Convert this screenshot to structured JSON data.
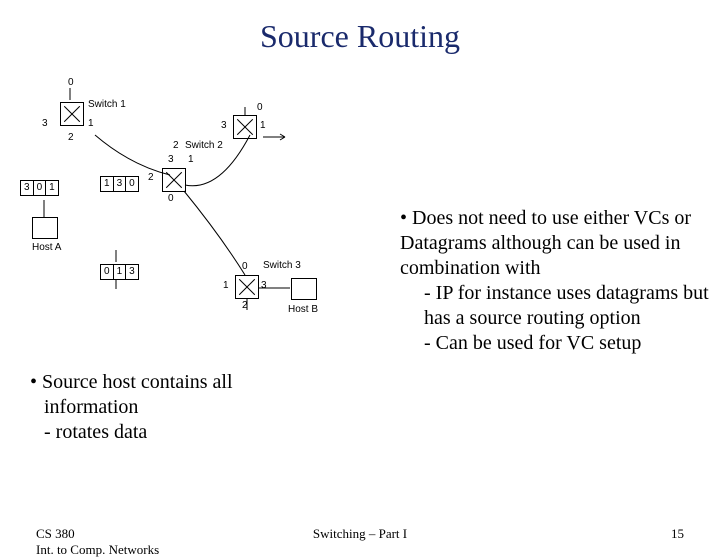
{
  "title": "Source Routing",
  "diagram": {
    "switches": [
      {
        "name": "Switch 1",
        "ports": {
          "top": "0",
          "left": "3",
          "right": "1",
          "bottom": "2"
        }
      },
      {
        "name": "Switch 2",
        "ports": {
          "top": "0",
          "left": "3",
          "right": "1",
          "bottom": "2"
        }
      },
      {
        "name": "",
        "ports": {
          "top": "3",
          "left": "2",
          "right": "1",
          "bottom": "0"
        }
      },
      {
        "name": "Switch 3",
        "ports": {
          "top": "0",
          "left": "1",
          "right": "3",
          "bottom": "2"
        }
      }
    ],
    "hosts": [
      {
        "name": "Host A"
      },
      {
        "name": "Host B"
      }
    ],
    "packets": [
      {
        "cells": [
          "3",
          "0",
          "1"
        ]
      },
      {
        "cells": [
          "1",
          "3",
          "0"
        ]
      },
      {
        "cells": [
          "0",
          "1",
          "3"
        ]
      }
    ]
  },
  "left_bullet": {
    "lead": "• Source host contains all",
    "line2": "information",
    "line3": "- rotates data"
  },
  "right_bullet": {
    "lead": "• Does not need to use either VCs or Datagrams although can be used in combination with",
    "sub1": "- IP for instance uses datagrams but has a source routing option",
    "sub2": "- Can be used for VC setup"
  },
  "footer": {
    "course_code": "CS 380",
    "course_name": "Int. to Comp. Networks",
    "center": "Switching – Part I",
    "page": "15"
  }
}
